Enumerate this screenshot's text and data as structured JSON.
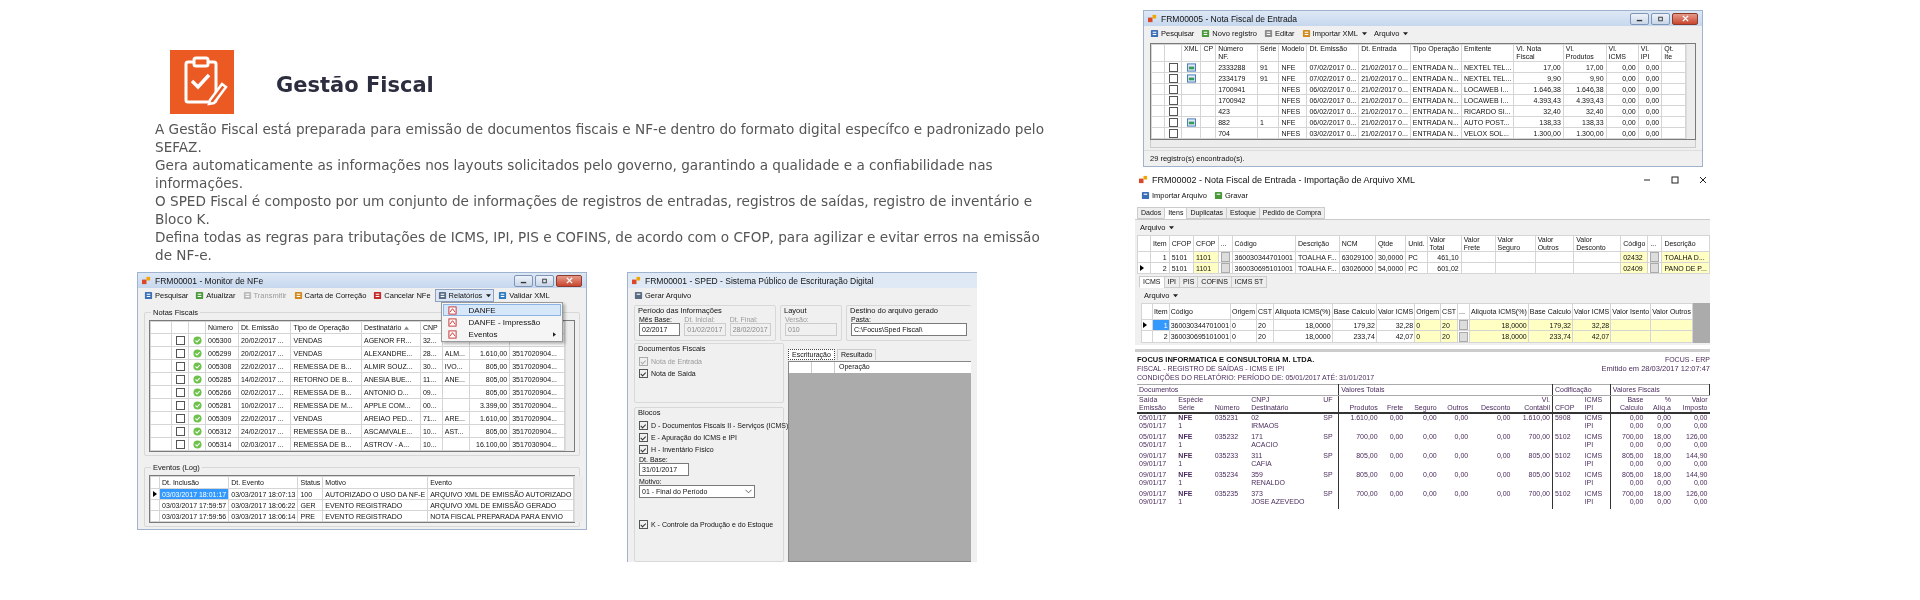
{
  "header": {
    "title": "Gestão Fiscal"
  },
  "paragraphs": [
    "A Gestão Fiscal está preparada para emissão de documentos fiscais e NF-e dentro do formato digital específco e padronizado pelo SEFAZ.",
    "Gera automaticamente as informações nos layouts solicitados pelo governo, garantindo a qualidade e a confiabilidade nas informações.",
    "O SPED Fiscal é composto por um conjunto de informações de registros de entradas, registros de saídas, registro de inventário e Bloco K.",
    "Defina todas as regras para tributações de ICMS, IPI, PIS e COFINS, de acordo com o CFOP, para agilizar e evitar erros na emissão de NF-e."
  ],
  "monitor": {
    "title": "FRM00001 - Monitor de NFe",
    "toolbar": [
      {
        "label": "Pesquisar",
        "kind": "button",
        "disabled": false
      },
      {
        "label": "Atualizar",
        "kind": "button",
        "disabled": false
      },
      {
        "label": "Transmitir",
        "kind": "button",
        "disabled": true
      },
      {
        "label": "Carta de Correção",
        "kind": "button",
        "disabled": false
      },
      {
        "label": "Cancelar NFe",
        "kind": "button",
        "disabled": false
      },
      {
        "label": "Relatórios",
        "kind": "dropdown",
        "disabled": false
      },
      {
        "label": "Validar XML",
        "kind": "button",
        "disabled": false
      }
    ],
    "menu": {
      "open": true,
      "items": [
        {
          "label": "DANFE",
          "selected": true,
          "submenu": false
        },
        {
          "label": "DANFE - Impressão",
          "selected": false,
          "submenu": false
        },
        {
          "label": "Eventos",
          "selected": false,
          "submenu": true
        }
      ]
    },
    "group": "Notas Fiscais",
    "columns": [
      {
        "label": "Número",
        "sorted": false
      },
      {
        "label": "Dt. Emissão",
        "sorted": false
      },
      {
        "label": "Tipo de Operação",
        "sorted": false
      },
      {
        "label": "Destinatário",
        "sorted": true
      },
      {
        "label": "CNP",
        "sorted": false
      }
    ],
    "rows": [
      {
        "checked": false,
        "authorized": true,
        "numero": "005300",
        "emissao": "20/02/2017 ...",
        "tipo": "VENDAS",
        "destinatario": "AGENOR FR...",
        "cnp": "32..."
      },
      {
        "checked": false,
        "authorized": true,
        "numero": "005299",
        "emissao": "20/02/2017 ...",
        "tipo": "VENDAS",
        "destinatario": "ALEXANDRE...",
        "cnp": "28...",
        "column_6": "ALM...",
        "column_7": "1.610,00",
        "column_8": "3517020904..."
      },
      {
        "checked": false,
        "authorized": true,
        "numero": "005308",
        "emissao": "22/02/2017 ...",
        "tipo": "REMESSA DE B...",
        "destinatario": "ALMIR SOUZ...",
        "cnp": "30...",
        "column_6": "IVO...",
        "column_7": "805,00",
        "column_8": "3517020904..."
      },
      {
        "checked": false,
        "authorized": true,
        "numero": "005285",
        "emissao": "14/02/2017 ...",
        "tipo": "RETORNO DE B...",
        "destinatario": "ANESIA BUE...",
        "cnp": "11...",
        "column_6": "ANE...",
        "column_7": "805,00",
        "column_8": "3517020904..."
      },
      {
        "checked": false,
        "authorized": true,
        "numero": "005266",
        "emissao": "02/02/2017 ...",
        "tipo": "REMESSA DE B...",
        "destinatario": "ANTONIO D...",
        "cnp": "09...",
        "column_7": "805,00",
        "column_8": "3517020904..."
      },
      {
        "checked": false,
        "authorized": true,
        "numero": "005281",
        "emissao": "10/02/2017 ...",
        "tipo": "REMESSA DE M...",
        "destinatario": "APPLE COM...",
        "cnp": "00...",
        "column_7": "3.399,00",
        "column_8": "3517020904..."
      },
      {
        "checked": false,
        "authorized": true,
        "numero": "005309",
        "emissao": "22/02/2017 ...",
        "tipo": "VENDAS",
        "destinatario": "AREIAO PED...",
        "cnp": "71...",
        "column_6": "ARE...",
        "column_7": "1.610,00",
        "column_8": "3517020904..."
      },
      {
        "checked": false,
        "authorized": true,
        "numero": "005312",
        "emissao": "24/02/2017 ...",
        "tipo": "REMESSA DE B...",
        "destinatario": "ASCAMVALE...",
        "cnp": "10...",
        "column_6": "AST...",
        "column_7": "805,00",
        "column_8": "3517020904..."
      },
      {
        "checked": false,
        "authorized": true,
        "numero": "005314",
        "emissao": "02/03/2017 ...",
        "tipo": "REMESSA DE B...",
        "destinatario": "ASTROV - A...",
        "cnp": "10...",
        "column_7": "16.100,00",
        "column_8": "3517030904..."
      }
    ],
    "log_group": "Eventos (Log)",
    "log_columns": [
      "Dt. Inclusão",
      "Dt. Evento",
      "Status",
      "Motivo",
      "Evento"
    ],
    "log_rows": [
      {
        "current": true,
        "selected": true,
        "cells": [
          "03/03/2017 18:01:17",
          "03/03/2017 18:07:13",
          "100",
          "AUTORIZADO O USO DA NF-E",
          "ARQUIVO XML DE EMISSÃO AUTORIZADO"
        ]
      },
      {
        "current": false,
        "selected": false,
        "cells": [
          "03/03/2017 17:59:57",
          "03/03/2017 18:06:22",
          "GER",
          "EVENTO REGISTRADO",
          "ARQUIVO XML DE EMISSÃO GERADO"
        ]
      },
      {
        "current": false,
        "selected": false,
        "cells": [
          "03/03/2017 17:59:56",
          "03/03/2017 18:06:14",
          "PRE",
          "EVENTO REGISTRADO",
          "NOTA FISCAL PREPARADA PARA ENVIO"
        ]
      }
    ]
  },
  "sped": {
    "title": "FRM00001 - SPED - Sistema Público de Escrituração Digital",
    "toolbar": [
      {
        "label": "Gerar Arquivo",
        "kind": "button",
        "disabled": false
      }
    ],
    "groups": [
      {
        "label": "Período das Informações",
        "fields": [
          {
            "label": "Mês Base:",
            "value": "02/2017",
            "disabled": false
          },
          {
            "label": "Dt. Inicial:",
            "value": "01/02/2017",
            "disabled": true
          },
          {
            "label": "Dt. Final:",
            "value": "28/02/2017",
            "disabled": true
          }
        ]
      },
      {
        "label": "Layout",
        "fields": [
          {
            "label": "Versão:",
            "value": "010",
            "disabled": true
          }
        ]
      },
      {
        "label": "Destino do arquivo gerado",
        "fields": [
          {
            "label": "Pasta:",
            "value": "C:\\Focus\\Sped Fiscal\\",
            "disabled": false
          }
        ]
      }
    ],
    "documentos": {
      "label": "Documentos Fiscais",
      "options": [
        {
          "label": "Nota de Entrada",
          "checked": true,
          "disabled": true
        },
        {
          "label": "Nota de Saída",
          "checked": true,
          "disabled": false
        }
      ]
    },
    "blocos": {
      "label": "Blocos",
      "items": [
        {
          "kind": "checkbox",
          "label": "D - Documentos Fiscais II - Serviços (ICMS)",
          "checked": true
        },
        {
          "kind": "checkbox",
          "label": "E - Apuração do ICMS e IPI",
          "checked": true
        },
        {
          "kind": "checkbox",
          "label": "H - Inventário Físico",
          "checked": true
        },
        {
          "kind": "text",
          "label": "Dt. Base:",
          "value": "31/01/2017"
        },
        {
          "kind": "select",
          "label": "Motivo:",
          "value": "01 - Final do Período"
        },
        {
          "kind": "checkbox",
          "label": "K - Controle da Produção e do Estoque",
          "checked": true
        }
      ]
    },
    "tabs": [
      {
        "label": "Escrituração",
        "selected": true
      },
      {
        "label": "Resultado",
        "selected": false
      }
    ],
    "grid_column": "Operação"
  },
  "entrada": {
    "title": "FRM00005 - Nota Fiscal de Entrada",
    "toolbar": [
      {
        "label": "Pesquisar",
        "kind": "button",
        "disabled": false
      },
      {
        "label": "Novo registro",
        "kind": "button",
        "disabled": false
      },
      {
        "label": "Editar",
        "kind": "button",
        "disabled": false
      },
      {
        "label": "Importar XML",
        "kind": "dropdown",
        "disabled": false
      },
      {
        "label": "Arquivo",
        "kind": "menu",
        "disabled": false
      }
    ],
    "columns": [
      "XML",
      "CP",
      "Número NF.",
      "Série",
      "Modelo",
      "Dt. Emissão",
      "Dt. Entrada",
      "Tipo Operação",
      "Emitente",
      "Vl. Nota Fiscal",
      "Vl. Produtos",
      "Vl. ICMS",
      "Vl. IPI",
      "Qt. Ite"
    ],
    "rows": [
      {
        "checked": false,
        "xml": true,
        "numero": "2333288",
        "serie": "91",
        "modelo": "NFE",
        "emissao": "07/02/2017 0...",
        "entrada": "21/02/2017 0...",
        "tipo": "ENTRADA N...",
        "emitente": "NEXTEL TEL...",
        "valor_nota": "17,00",
        "valor_produtos": "17,00",
        "valor_icms": "0,00",
        "valor_ipi": "0,00"
      },
      {
        "checked": false,
        "xml": true,
        "numero": "2334179",
        "serie": "91",
        "modelo": "NFE",
        "emissao": "07/02/2017 0...",
        "entrada": "21/02/2017 0...",
        "tipo": "ENTRADA N...",
        "emitente": "NEXTEL TEL...",
        "valor_nota": "9,90",
        "valor_produtos": "9,90",
        "valor_icms": "0,00",
        "valor_ipi": "0,00"
      },
      {
        "checked": false,
        "xml": false,
        "numero": "1700941",
        "modelo": "NFES",
        "emissao": "06/02/2017 0...",
        "entrada": "21/02/2017 0...",
        "tipo": "ENTRADA N...",
        "emitente": "LOCAWEB I...",
        "valor_nota": "1.646,38",
        "valor_produtos": "1.646,38",
        "valor_icms": "0,00",
        "valor_ipi": "0,00"
      },
      {
        "checked": false,
        "xml": false,
        "numero": "1700942",
        "modelo": "NFES",
        "emissao": "06/02/2017 0...",
        "entrada": "21/02/2017 0...",
        "tipo": "ENTRADA N...",
        "emitente": "LOCAWEB I...",
        "valor_nota": "4.393,43",
        "valor_produtos": "4.393,43",
        "valor_icms": "0,00",
        "valor_ipi": "0,00"
      },
      {
        "checked": false,
        "xml": false,
        "numero": "423",
        "modelo": "NFES",
        "emissao": "06/02/2017 0...",
        "entrada": "21/02/2017 0...",
        "tipo": "ENTRADA N...",
        "emitente": "RICARDO SI...",
        "valor_nota": "32,40",
        "valor_produtos": "32,40",
        "valor_icms": "0,00",
        "valor_ipi": "0,00"
      },
      {
        "checked": false,
        "xml": true,
        "numero": "882",
        "serie": "1",
        "modelo": "NFE",
        "emissao": "06/02/2017 0...",
        "entrada": "21/02/2017 0...",
        "tipo": "ENTRADA N...",
        "emitente": "AUTO POST...",
        "valor_nota": "138,33",
        "valor_produtos": "138,33",
        "valor_icms": "0,00",
        "valor_ipi": "0,00"
      },
      {
        "checked": false,
        "xml": false,
        "numero": "704",
        "modelo": "NFES",
        "emissao": "03/02/2017 0...",
        "entrada": "21/02/2017 0...",
        "tipo": "ENTRADA N...",
        "emitente": "VELOX SOL...",
        "valor_nota": "1.300,00",
        "valor_produtos": "1.300,00",
        "valor_icms": "0,00",
        "valor_ipi": "0,00"
      }
    ],
    "status_bar": "29 registro(s) encontrado(s)."
  },
  "importacao": {
    "title": "FRM00002 - Nota Fiscal de Entrada - Importação de Arquivo XML",
    "toolbar": [
      {
        "label": "Importar Arquivo",
        "kind": "button",
        "disabled": false
      },
      {
        "label": "Gravar",
        "kind": "button",
        "disabled": false
      }
    ],
    "tabs": [
      {
        "label": "Dados",
        "selected": false
      },
      {
        "label": "Itens",
        "selected": true
      },
      {
        "label": "Duplicatas",
        "selected": false
      },
      {
        "label": "Estoque",
        "selected": false
      },
      {
        "label": "Pedido de Compra",
        "selected": false
      }
    ],
    "menu": "Arquivo",
    "columns": [
      {
        "label": "Item",
        "kind": "number",
        "highlighted": false
      },
      {
        "label": "CFOP",
        "kind": "text",
        "highlighted": false
      },
      {
        "label": "CFOP",
        "kind": "text",
        "highlighted": true
      },
      {
        "label": "...",
        "kind": "button",
        "highlighted": false
      },
      {
        "label": "Código",
        "kind": "text",
        "highlighted": false
      },
      {
        "label": "Descrição",
        "kind": "text",
        "highlighted": false
      },
      {
        "label": "NCM",
        "kind": "text",
        "highlighted": false
      },
      {
        "label": "Qtde",
        "kind": "number",
        "highlighted": false
      },
      {
        "label": "Unid.",
        "kind": "text",
        "highlighted": false
      },
      {
        "label": "Valor Total",
        "kind": "number",
        "highlighted": false
      },
      {
        "label": "Valor Frete",
        "kind": "number",
        "highlighted": false
      },
      {
        "label": "Valor Seguro",
        "kind": "number",
        "highlighted": false
      },
      {
        "label": "Valor Outros",
        "kind": "number",
        "highlighted": false
      },
      {
        "label": "Valor Desconto",
        "kind": "number",
        "highlighted": false
      },
      {
        "label": "Código",
        "kind": "text",
        "highlighted": true
      },
      {
        "label": "...",
        "kind": "button",
        "highlighted": false
      },
      {
        "label": "Descrição",
        "kind": "text",
        "highlighted": true
      }
    ],
    "rows": [
      {
        "current": false,
        "item": "1",
        "cfop": "5101",
        "cfop_2": "1101",
        "codigo": "360030344701001",
        "descricao": "TOALHA F...",
        "ncm": "63029100",
        "qtde": "30,0000",
        "unid": "PC",
        "valor_total": "461,10",
        "codigo_2": "02432",
        "descricao_2": "TOALHA D..."
      },
      {
        "current": true,
        "item": "2",
        "cfop": "5101",
        "cfop_2": "1101",
        "codigo": "360030695101001",
        "descricao": "TOALHA F...",
        "ncm": "63026000",
        "qtde": "54,0000",
        "unid": "PC",
        "valor_total": "601,02",
        "codigo_2": "02409",
        "descricao_2": "PANO DE P..."
      }
    ],
    "subtabs": [
      {
        "label": "ICMS",
        "selected": true
      },
      {
        "label": "IPI",
        "selected": false
      },
      {
        "label": "PIS",
        "selected": false
      },
      {
        "label": "COFINS",
        "selected": false
      },
      {
        "label": "ICMS ST",
        "selected": false
      }
    ],
    "submenu": "Arquivo",
    "tax_columns": [
      {
        "label": "Item",
        "kind": "number",
        "highlighted": false
      },
      {
        "label": "Código",
        "kind": "text",
        "highlighted": false
      },
      {
        "label": "Origem",
        "kind": "text",
        "highlighted": false
      },
      {
        "label": "CST",
        "kind": "text",
        "highlighted": false
      },
      {
        "label": "Aliquota ICMS(%)",
        "kind": "number",
        "highlighted": false
      },
      {
        "label": "Base Calculo",
        "kind": "number",
        "highlighted": false
      },
      {
        "label": "Valor ICMS",
        "kind": "number",
        "highlighted": false
      },
      {
        "label": "Origem",
        "kind": "text",
        "highlighted": true
      },
      {
        "label": "CST",
        "kind": "text",
        "highlighted": true
      },
      {
        "label": "...",
        "kind": "button",
        "highlighted": false
      },
      {
        "label": "Aliquota ICMS(%)",
        "kind": "number",
        "highlighted": true
      },
      {
        "label": "Base Calculo",
        "kind": "number",
        "highlighted": true
      },
      {
        "label": "Valor ICMS",
        "kind": "number",
        "highlighted": true
      },
      {
        "label": "Valor Isento",
        "kind": "number",
        "highlighted": true
      },
      {
        "label": "Valor Outros",
        "kind": "number",
        "highlighted": true
      }
    ],
    "tax_rows": [
      {
        "current": true,
        "selected": true,
        "item": "1",
        "codigo": "360030344701001",
        "origem": "0",
        "cst": "20",
        "aliquota": "18,0000",
        "base": "179,32",
        "valor": "32,28",
        "origem_2": "0",
        "cst_2": "20",
        "aliquota_2": "18,0000",
        "base_2": "179,32",
        "valor_2": "32,28"
      },
      {
        "current": false,
        "selected": false,
        "item": "2",
        "codigo": "360030695101001",
        "origem": "0",
        "cst": "20",
        "aliquota": "18,0000",
        "base": "233,74",
        "valor": "42,07",
        "origem_2": "0",
        "cst_2": "20",
        "aliquota_2": "18,0000",
        "base_2": "233,74",
        "valor_2": "42,07"
      }
    ]
  },
  "report": {
    "company": "FOCUS INFORMATICA E CONSULTORIA M. LTDA.",
    "system": "FOCUS - ERP",
    "title": "FISCAL - REGISTRO DE SAÍDAS - ICMS E IPI",
    "issued": "Emitido em 28/03/2017 12:07:47",
    "conditions": "CONDIÇÕES DO RELATÓRIO: PERÍODO DE: 05/01/2017 ATÉ: 31/01/2017",
    "groups": [
      "Documentos",
      "Valores Totais",
      "Codificação",
      "Valores Fiscais"
    ],
    "columns": [
      {
        "top": "Saída",
        "bottom": "Emissão"
      },
      {
        "top": "Espécie",
        "bottom": "Série"
      },
      {
        "bottom": "Número"
      },
      {
        "top": "CNPJ",
        "bottom": "Destinatário"
      },
      {
        "top": "UF"
      },
      {
        "bottom": "Produtos"
      },
      {
        "bottom": "Frete"
      },
      {
        "bottom": "Seguro"
      },
      {
        "bottom": "Outros"
      },
      {
        "bottom": "Desconto"
      },
      {
        "top": "Vl.",
        "bottom": "Contábil"
      },
      {
        "bottom": "CFOP"
      },
      {
        "top": "ICMS",
        "bottom": "IPI"
      },
      {
        "top": "Base",
        "bottom": "Calculo"
      },
      {
        "top": "%",
        "bottom": "Alíq.a"
      },
      {
        "top": "Valor",
        "bottom": "Imposto"
      }
    ],
    "entries": [
      {
        "saida": "05/01/17",
        "especie": "NFE",
        "numero": "035231",
        "cnpj": "02",
        "uf": "SP",
        "produtos": "1.610,00",
        "frete": "0,00",
        "seguro": "0,00",
        "outros": "0,00",
        "desconto": "0,00",
        "contabil": "1.610,00",
        "cfop": "5908",
        "icms": "ICMS",
        "icms_base": "0,00",
        "icms_aliquota": "0,00",
        "icms_valor": "0,00",
        "emissao": "05/01/17",
        "serie": "1",
        "destinatario": "IRMAOS",
        "ipi": "IPI",
        "ipi_base": "0,00",
        "ipi_aliquota": "0,00",
        "ipi_valor": "0,00"
      },
      {
        "saida": "05/01/17",
        "especie": "NFE",
        "numero": "035232",
        "cnpj": "171",
        "uf": "SP",
        "produtos": "700,00",
        "frete": "0,00",
        "seguro": "0,00",
        "outros": "0,00",
        "desconto": "0,00",
        "contabil": "700,00",
        "cfop": "5102",
        "icms": "ICMS",
        "icms_base": "700,00",
        "icms_aliquota": "18,00",
        "icms_valor": "126,00",
        "emissao": "05/01/17",
        "serie": "1",
        "destinatario": "ACACIO",
        "ipi": "IPI",
        "ipi_base": "0,00",
        "ipi_aliquota": "0,00",
        "ipi_valor": "0,00"
      },
      {
        "saida": "09/01/17",
        "especie": "NFE",
        "numero": "035233",
        "cnpj": "311",
        "uf": "SP",
        "produtos": "805,00",
        "frete": "0,00",
        "seguro": "0,00",
        "outros": "0,00",
        "desconto": "0,00",
        "contabil": "805,00",
        "cfop": "5102",
        "icms": "ICMS",
        "icms_base": "805,00",
        "icms_aliquota": "18,00",
        "icms_valor": "144,90",
        "emissao": "09/01/17",
        "serie": "1",
        "destinatario": "CAFIA",
        "ipi": "IPI",
        "ipi_base": "0,00",
        "ipi_aliquota": "0,00",
        "ipi_valor": "0,00"
      },
      {
        "saida": "09/01/17",
        "especie": "NFE",
        "numero": "035234",
        "cnpj": "359",
        "uf": "SP",
        "produtos": "805,00",
        "frete": "0,00",
        "seguro": "0,00",
        "outros": "0,00",
        "desconto": "0,00",
        "contabil": "805,00",
        "cfop": "5102",
        "icms": "ICMS",
        "icms_base": "805,00",
        "icms_aliquota": "18,00",
        "icms_valor": "144,90",
        "emissao": "09/01/17",
        "serie": "1",
        "destinatario": "RENALDO",
        "ipi": "IPI",
        "ipi_base": "0,00",
        "ipi_aliquota": "0,00",
        "ipi_valor": "0,00"
      },
      {
        "saida": "09/01/17",
        "especie": "NFE",
        "numero": "035235",
        "cnpj": "373",
        "uf": "SP",
        "produtos": "700,00",
        "frete": "0,00",
        "seguro": "0,00",
        "outros": "0,00",
        "desconto": "0,00",
        "contabil": "700,00",
        "cfop": "5102",
        "icms": "ICMS",
        "icms_base": "700,00",
        "icms_aliquota": "18,00",
        "icms_valor": "126,00",
        "emissao": "09/01/17",
        "serie": "1",
        "destinatario": "JOSE AZEVEDO",
        "ipi": "IPI",
        "ipi_base": "0,00",
        "ipi_aliquota": "0,00",
        "ipi_valor": "0,00"
      }
    ]
  }
}
